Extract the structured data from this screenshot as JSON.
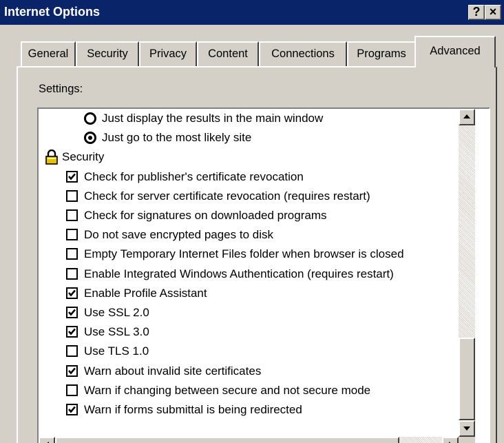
{
  "window": {
    "title": "Internet Options",
    "help_button": "?",
    "close_button": "×"
  },
  "tabs": [
    {
      "label": "General",
      "active": false
    },
    {
      "label": "Security",
      "active": false
    },
    {
      "label": "Privacy",
      "active": false
    },
    {
      "label": "Content",
      "active": false
    },
    {
      "label": "Connections",
      "active": false
    },
    {
      "label": "Programs",
      "active": false
    },
    {
      "label": "Advanced",
      "active": true
    }
  ],
  "settings": {
    "label": "Settings:",
    "items": [
      {
        "kind": "radio",
        "label": "Just display the results in the main window",
        "checked": false
      },
      {
        "kind": "radio",
        "label": "Just go to the most likely site",
        "checked": true
      },
      {
        "kind": "group",
        "label": "Security",
        "icon": "lock-icon"
      },
      {
        "kind": "checkbox",
        "label": "Check for publisher's certificate revocation",
        "checked": true
      },
      {
        "kind": "checkbox",
        "label": "Check for server certificate revocation (requires restart)",
        "checked": false
      },
      {
        "kind": "checkbox",
        "label": "Check for signatures on downloaded programs",
        "checked": false
      },
      {
        "kind": "checkbox",
        "label": "Do not save encrypted pages to disk",
        "checked": false
      },
      {
        "kind": "checkbox",
        "label": "Empty Temporary Internet Files folder when browser is closed",
        "checked": false
      },
      {
        "kind": "checkbox",
        "label": "Enable Integrated Windows Authentication (requires restart)",
        "checked": false
      },
      {
        "kind": "checkbox",
        "label": "Enable Profile Assistant",
        "checked": true
      },
      {
        "kind": "checkbox",
        "label": "Use SSL 2.0",
        "checked": true
      },
      {
        "kind": "checkbox",
        "label": "Use SSL 3.0",
        "checked": true
      },
      {
        "kind": "checkbox",
        "label": "Use TLS 1.0",
        "checked": false
      },
      {
        "kind": "checkbox",
        "label": "Warn about invalid site certificates",
        "checked": true
      },
      {
        "kind": "checkbox",
        "label": "Warn if changing between secure and not secure mode",
        "checked": false
      },
      {
        "kind": "checkbox",
        "label": "Warn if forms submittal is being redirected",
        "checked": true
      }
    ]
  },
  "colors": {
    "titlebar": "#0a246a",
    "face": "#d4d0c8",
    "list_bg": "#ffffff",
    "lock": "#e8c000"
  }
}
